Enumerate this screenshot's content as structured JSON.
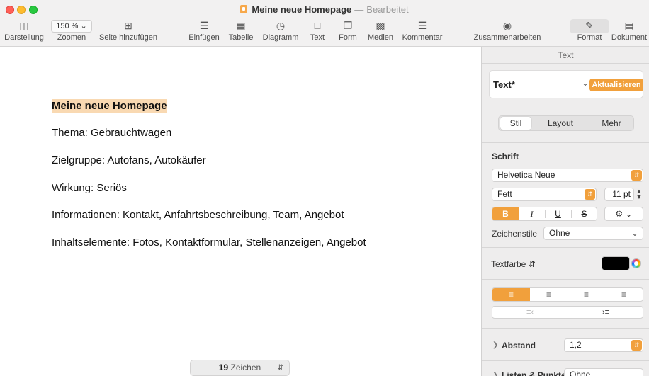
{
  "window": {
    "title": "Meine neue Homepage",
    "separator": "—",
    "status": "Bearbeitet"
  },
  "toolbar": {
    "view": {
      "label": "Darstellung",
      "icon": "sidebar-icon"
    },
    "zoom": {
      "label": "Zoomen",
      "value": "150 %"
    },
    "add_page": {
      "label": "Seite hinzufügen",
      "icon": "plus-square-icon"
    },
    "insert": {
      "label": "Einfügen",
      "icon": "insert-list-icon"
    },
    "table": {
      "label": "Tabelle",
      "icon": "table-icon"
    },
    "chart": {
      "label": "Diagramm",
      "icon": "chart-icon"
    },
    "text": {
      "label": "Text",
      "icon": "text-box-icon"
    },
    "shape": {
      "label": "Form",
      "icon": "shape-icon"
    },
    "media": {
      "label": "Medien",
      "icon": "media-icon"
    },
    "comment": {
      "label": "Kommentar",
      "icon": "comment-icon"
    },
    "collaborate": {
      "label": "Zusammenarbeiten",
      "icon": "collaborate-icon"
    },
    "format": {
      "label": "Format",
      "icon": "paintbrush-icon"
    },
    "document": {
      "label": "Dokument",
      "icon": "document-icon"
    }
  },
  "document": {
    "heading": "Meine neue Homepage",
    "lines": [
      "Thema: Gebrauchtwagen",
      "Zielgruppe: Autofans, Autokäufer",
      "Wirkung: Seriös",
      "Informationen: Kontakt, Anfahrtsbeschreibung, Team, Angebot",
      "Inhaltselemente: Fotos, Kontaktformular, Stellenanzeigen, Angebot"
    ],
    "counter_value": "19",
    "counter_unit": "Zeichen"
  },
  "inspector": {
    "title": "Text",
    "paragraph_style": "Text*",
    "update_button": "Aktualisieren",
    "tabs": [
      "Stil",
      "Layout",
      "Mehr"
    ],
    "active_tab": "Stil",
    "font_section": "Schrift",
    "font_family": "Helvetica Neue",
    "font_weight": "Fett",
    "font_size": "11 pt",
    "format_buttons": [
      "B",
      "I",
      "U",
      "S"
    ],
    "char_styles_label": "Zeichenstile",
    "char_styles_value": "Ohne",
    "text_color_label": "Textfarbe",
    "text_color": "#000000",
    "spacing_label": "Abstand",
    "spacing_value": "1,2",
    "lists_label": "Listen & Punkte",
    "lists_value": "Ohne"
  },
  "colors": {
    "accent": "#f1a03c",
    "highlight": "#f9d9b2"
  }
}
